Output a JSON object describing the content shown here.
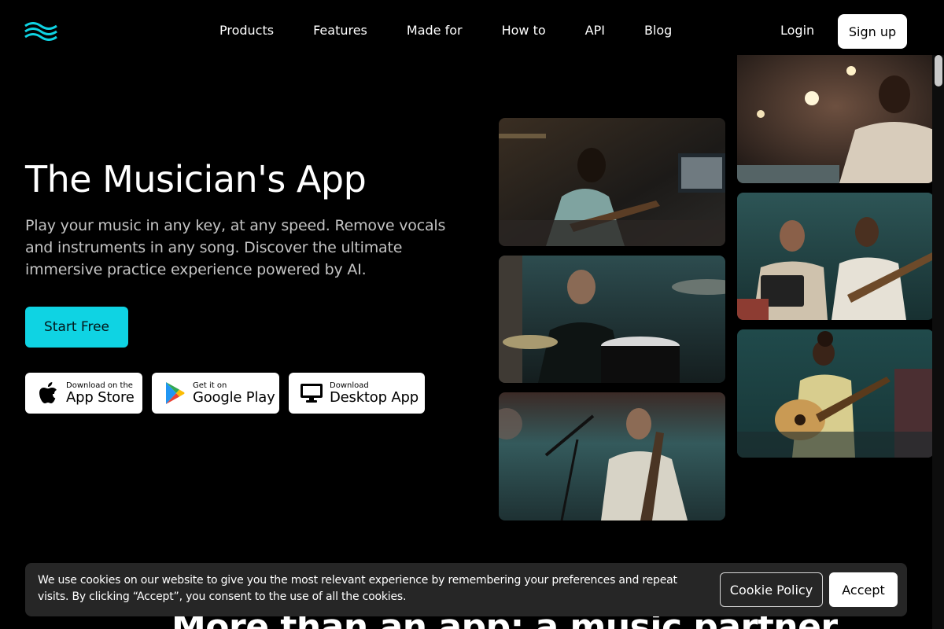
{
  "nav": {
    "logo_icon": "waves-logo-icon",
    "links": [
      "Products",
      "Features",
      "Made for",
      "How to",
      "API",
      "Blog"
    ],
    "login_label": "Login",
    "signup_label": "Sign up"
  },
  "hero": {
    "title": "The Musician's App",
    "subtitle": "Play your music in any key, at any speed. Remove vocals and instruments in any song. Discover the ultimate immersive practice experience powered by AI.",
    "start_label": "Start Free"
  },
  "stores": {
    "apple": {
      "small": "Download on the",
      "big": "App Store",
      "icon": "apple-icon"
    },
    "google": {
      "small": "Get it on",
      "big": "Google Play",
      "icon": "google-play-icon"
    },
    "desktop": {
      "small": "Download",
      "big": "Desktop App",
      "icon": "monitor-icon"
    }
  },
  "photos": [
    {
      "subject": "musician with headphones playing bass in studio"
    },
    {
      "subject": "musician singing into microphone under stage lights"
    },
    {
      "subject": "drummer playing drum kit"
    },
    {
      "subject": "duo with tablet and guitar"
    },
    {
      "subject": "guitarist with microphone stand"
    },
    {
      "subject": "woman playing acoustic guitar on sofa"
    }
  ],
  "cookie": {
    "text": "We use cookies on our website to give you the most relevant experience by remembering your preferences and repeat visits. By clicking “Accept”, you consent to the use of all the cookies.",
    "policy_label": "Cookie Policy",
    "accept_label": "Accept"
  },
  "next_section": {
    "heading": "More than an app: a music partner"
  },
  "colors": {
    "accent": "#0fd3e3",
    "background": "#000000",
    "cookie_bg": "#262626"
  }
}
